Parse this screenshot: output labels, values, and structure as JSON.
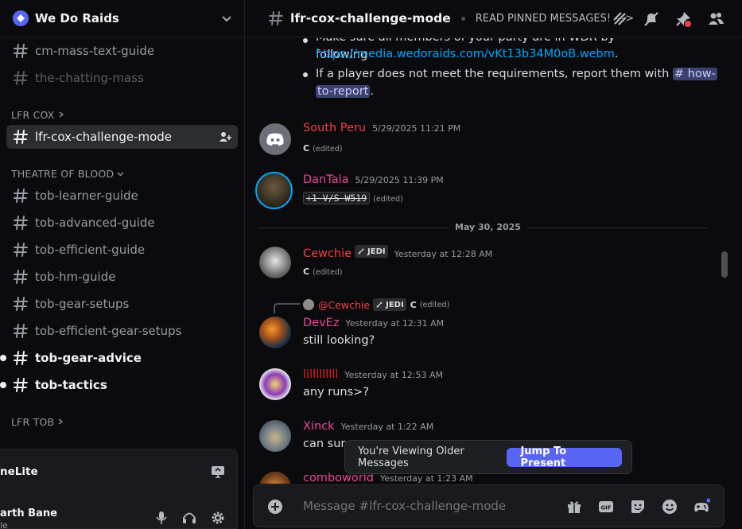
{
  "server": {
    "name": "We Do Raids"
  },
  "sidebar": {
    "channels_top": [
      {
        "label": "cm-mass-text-guide"
      },
      {
        "label": "the-chatting-mass"
      }
    ],
    "cat_lfr_cox": "LFR COX",
    "selected_channel": "lfr-cox-challenge-mode",
    "cat_tob": "THEATRE OF BLOOD",
    "tob_channels": [
      {
        "label": "tob-learner-guide"
      },
      {
        "label": "tob-advanced-guide"
      },
      {
        "label": "tob-efficient-guide"
      },
      {
        "label": "tob-hm-guide"
      },
      {
        "label": "tob-gear-setups"
      },
      {
        "label": "tob-efficient-gear-setups"
      },
      {
        "label": "tob-gear-advice"
      },
      {
        "label": "tob-tactics"
      }
    ],
    "cat_lfr_tob": "LFR TOB"
  },
  "voice_panel": {
    "name": "neLite"
  },
  "user_panel": {
    "name": "arth Bane",
    "status": "le"
  },
  "topbar": {
    "channel": "lfr-cox-challenge-mode",
    "topic": "READ PINNED MESSAGES! --->"
  },
  "chat": {
    "bullet1_prefix": "Make sure all members of your party are in WDR by following",
    "bullet1_link": "https://media.wedoraids.com/vKt13b34M0oB.webm",
    "bullet2_text": "If a player does not meet the requirements, report them with",
    "bullet2_mention_a": "# how-",
    "bullet2_mention_b": "to-report",
    "date_divider": "May 30, 2025",
    "edited_label": "(edited)",
    "jedi_label": "JEDI",
    "messages": [
      {
        "author": "South Peru",
        "time": "5/29/2025 11:21 PM",
        "text": "C",
        "color": "#f23f43"
      },
      {
        "author": "DanTala",
        "time": "5/29/2025 11:39 PM",
        "text": "+1 V/S W519",
        "color": "#eb459e"
      },
      {
        "author": "Cewchie",
        "time": "Yesterday at 12:28 AM",
        "text": "C",
        "color": "#f23f43"
      },
      {
        "author": "DevEz",
        "time": "Yesterday at 12:31 AM",
        "text": "still looking?",
        "color": "#eb459e",
        "reply_to": "@Cewchie",
        "reply_text": "C"
      },
      {
        "author": "lilllllllll",
        "time": "Yesterday at 12:53 AM",
        "text": "any runs>?",
        "color": "#e32020"
      },
      {
        "author": "Xinck",
        "time": "Yesterday at 1:22 AM",
        "text": "can surg",
        "color": "#eb459e"
      },
      {
        "author": "comboworld",
        "time": "Yesterday at 1:23 AM",
        "text": "",
        "color": "#eb459e"
      }
    ]
  },
  "older_banner": {
    "text": "You're Viewing Older Messages",
    "button": "Jump To Present"
  },
  "composer": {
    "placeholder": "Message #lfr-cox-challenge-mode"
  },
  "colors": {
    "accent": "#5865f2",
    "link": "#00a8fc",
    "background": "#0b0b0d"
  }
}
